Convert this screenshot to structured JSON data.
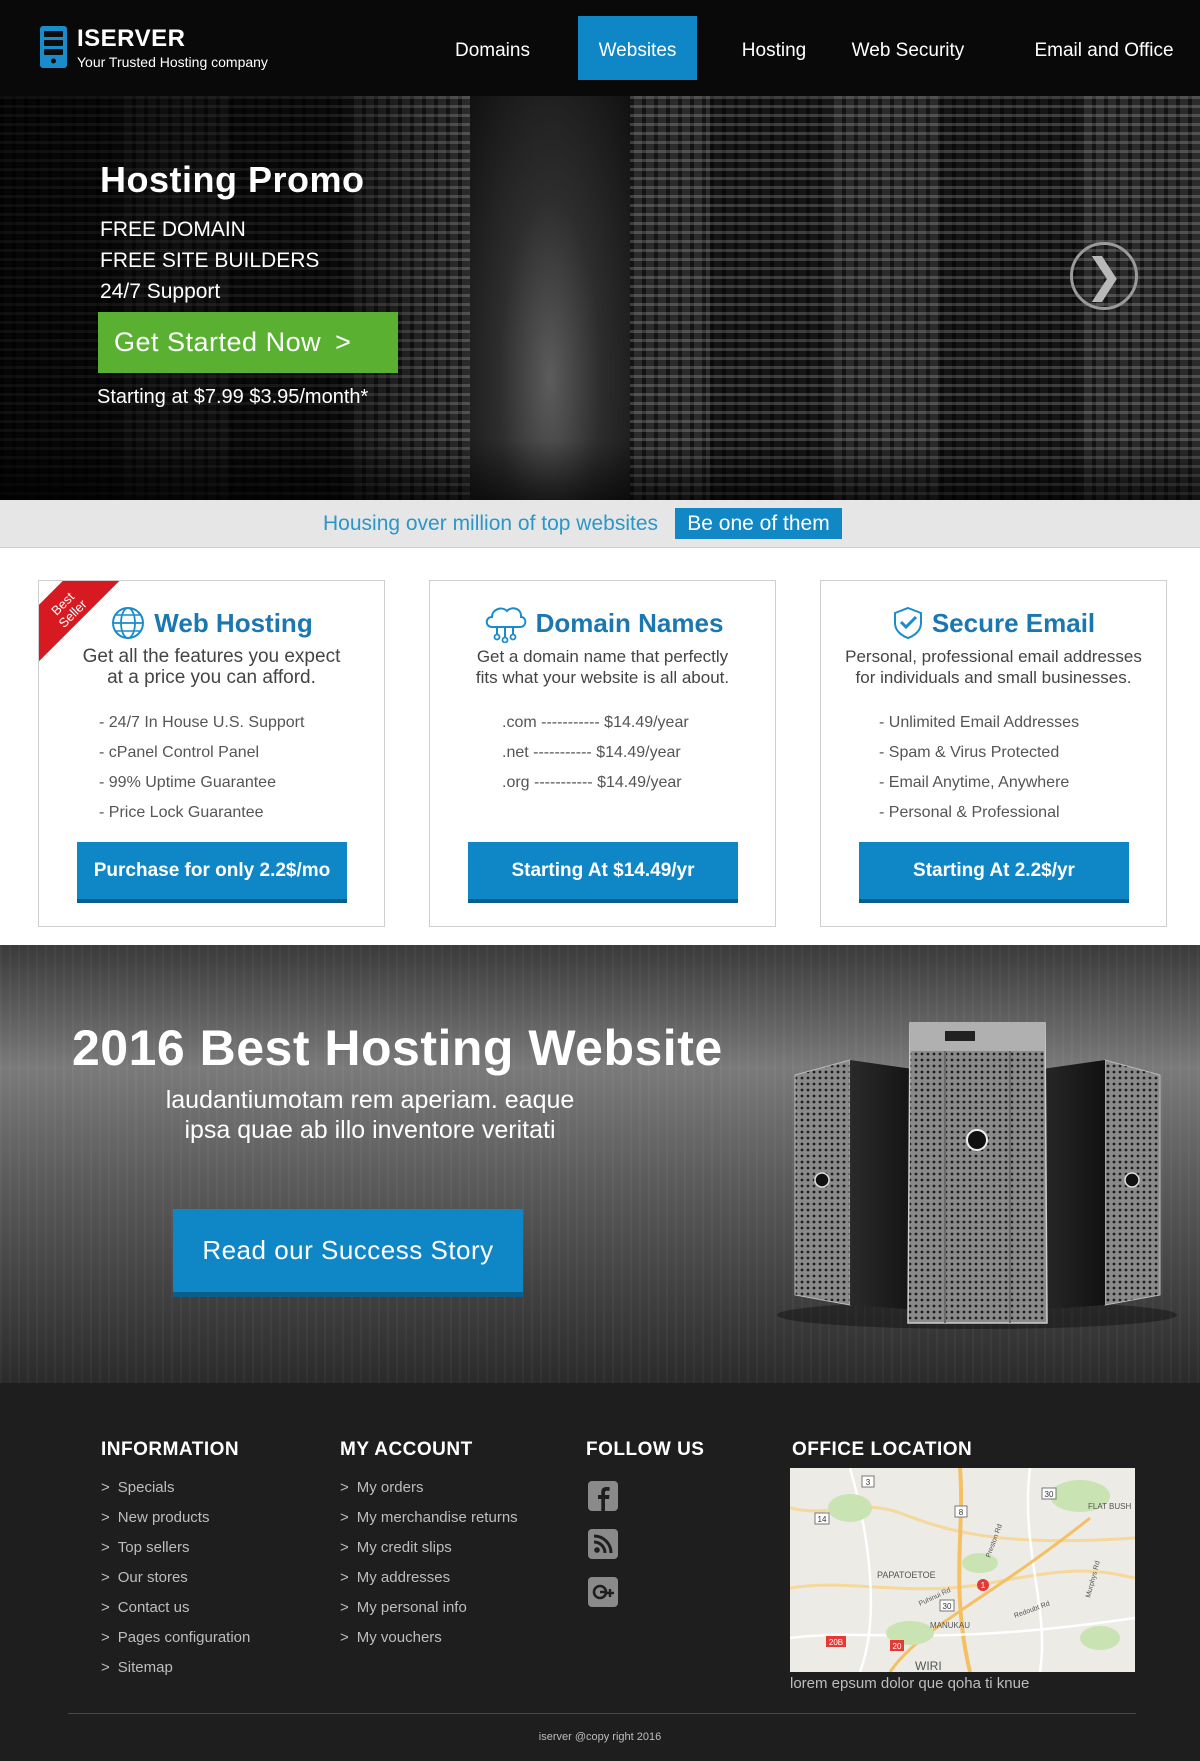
{
  "brand": {
    "name": "ISERVER",
    "tagline": "Your Trusted Hosting company",
    "accent_color": "#0f86c5",
    "green_color": "#5ab031"
  },
  "nav": {
    "items": [
      {
        "label": "Domains",
        "active": false
      },
      {
        "label": "Websites",
        "active": true
      },
      {
        "label": "Hosting",
        "active": false
      },
      {
        "label": "Web Security",
        "active": false
      },
      {
        "label": "Email and Office",
        "active": false
      }
    ]
  },
  "hero": {
    "title": "Hosting Promo",
    "features": [
      "FREE DOMAIN",
      "FREE SITE BUILDERS",
      "24/7 Support"
    ],
    "cta_label": "Get Started Now",
    "cta_arrow": ">",
    "price_text": "Starting at $7.99 $3.95/month*",
    "next_icon": "chevron-right-icon",
    "next_glyph": "❯"
  },
  "strip": {
    "text": "Housing over million of top websites",
    "badge": "Be one of them"
  },
  "cards": [
    {
      "icon": "globe-icon",
      "title": "Web Hosting",
      "subtitle_lines": [
        "Get all the features you expect",
        "at a price you can afford."
      ],
      "features": [
        "- 24/7 In House U.S. Support",
        "- cPanel Control Panel",
        "- 99% Uptime Guarantee",
        "- Price Lock Guarantee"
      ],
      "button": "Purchase for only 2.2$/mo",
      "ribbon": [
        "Best",
        "Seller"
      ]
    },
    {
      "icon": "cloud-network-icon",
      "title": "Domain Names",
      "subtitle_lines": [
        "Get a domain name that perfectly",
        "fits what your website is all about."
      ],
      "features": [
        ".com ----------- $14.49/year",
        ".net ----------- $14.49/year",
        ".org ----------- $14.49/year"
      ],
      "button": "Starting At $14.49/yr"
    },
    {
      "icon": "shield-check-icon",
      "title": "Secure Email",
      "subtitle_lines": [
        "Personal, professional email addresses",
        "for individuals and small businesses."
      ],
      "features": [
        "- Unlimited Email Addresses",
        "- Spam & Virus Protected",
        "- Email Anytime, Anywhere",
        "- Personal & Professional"
      ],
      "button": "Starting At 2.2$/yr"
    }
  ],
  "promo": {
    "title": "2016 Best Hosting Website",
    "subtitle_lines": [
      "laudantiumotam rem aperiam. eaque",
      "ipsa quae ab illo inventore veritati"
    ],
    "button": "Read our Success Story"
  },
  "footer": {
    "information": {
      "heading": "INFORMATION",
      "links": [
        "Specials",
        "New products",
        "Top sellers",
        "Our stores",
        "Contact us",
        "Pages configuration",
        "Sitemap"
      ]
    },
    "account": {
      "heading": "MY ACCOUNT",
      "links": [
        "My orders",
        "My merchandise returns",
        "My credit slips",
        "My addresses",
        "My personal info",
        "My vouchers"
      ]
    },
    "follow": {
      "heading": "FOLLOW US",
      "icons": [
        "facebook-icon",
        "rss-icon",
        "google-plus-icon"
      ]
    },
    "office": {
      "heading": "OFFICE LOCATION",
      "caption": "lorem epsum dolor que qoha ti knue",
      "map_labels": {
        "flat_bush": "FLAT BUSH",
        "papatoetoe": "PAPATOETOE",
        "manukau": "MANUKAU",
        "wiri": "WIRI",
        "preston": "Preston Rd",
        "puhinui": "Puhinui Rd",
        "redoubt": "Redoubt Rd",
        "murphys": "Murphys Rd",
        "r3": "3",
        "r30a": "30",
        "r14": "14",
        "r8": "8",
        "r1": "1",
        "r30b": "30",
        "r20b": "20B",
        "r20": "20"
      }
    },
    "copyright": "iserver @copy right 2016",
    "chevron": ">"
  }
}
